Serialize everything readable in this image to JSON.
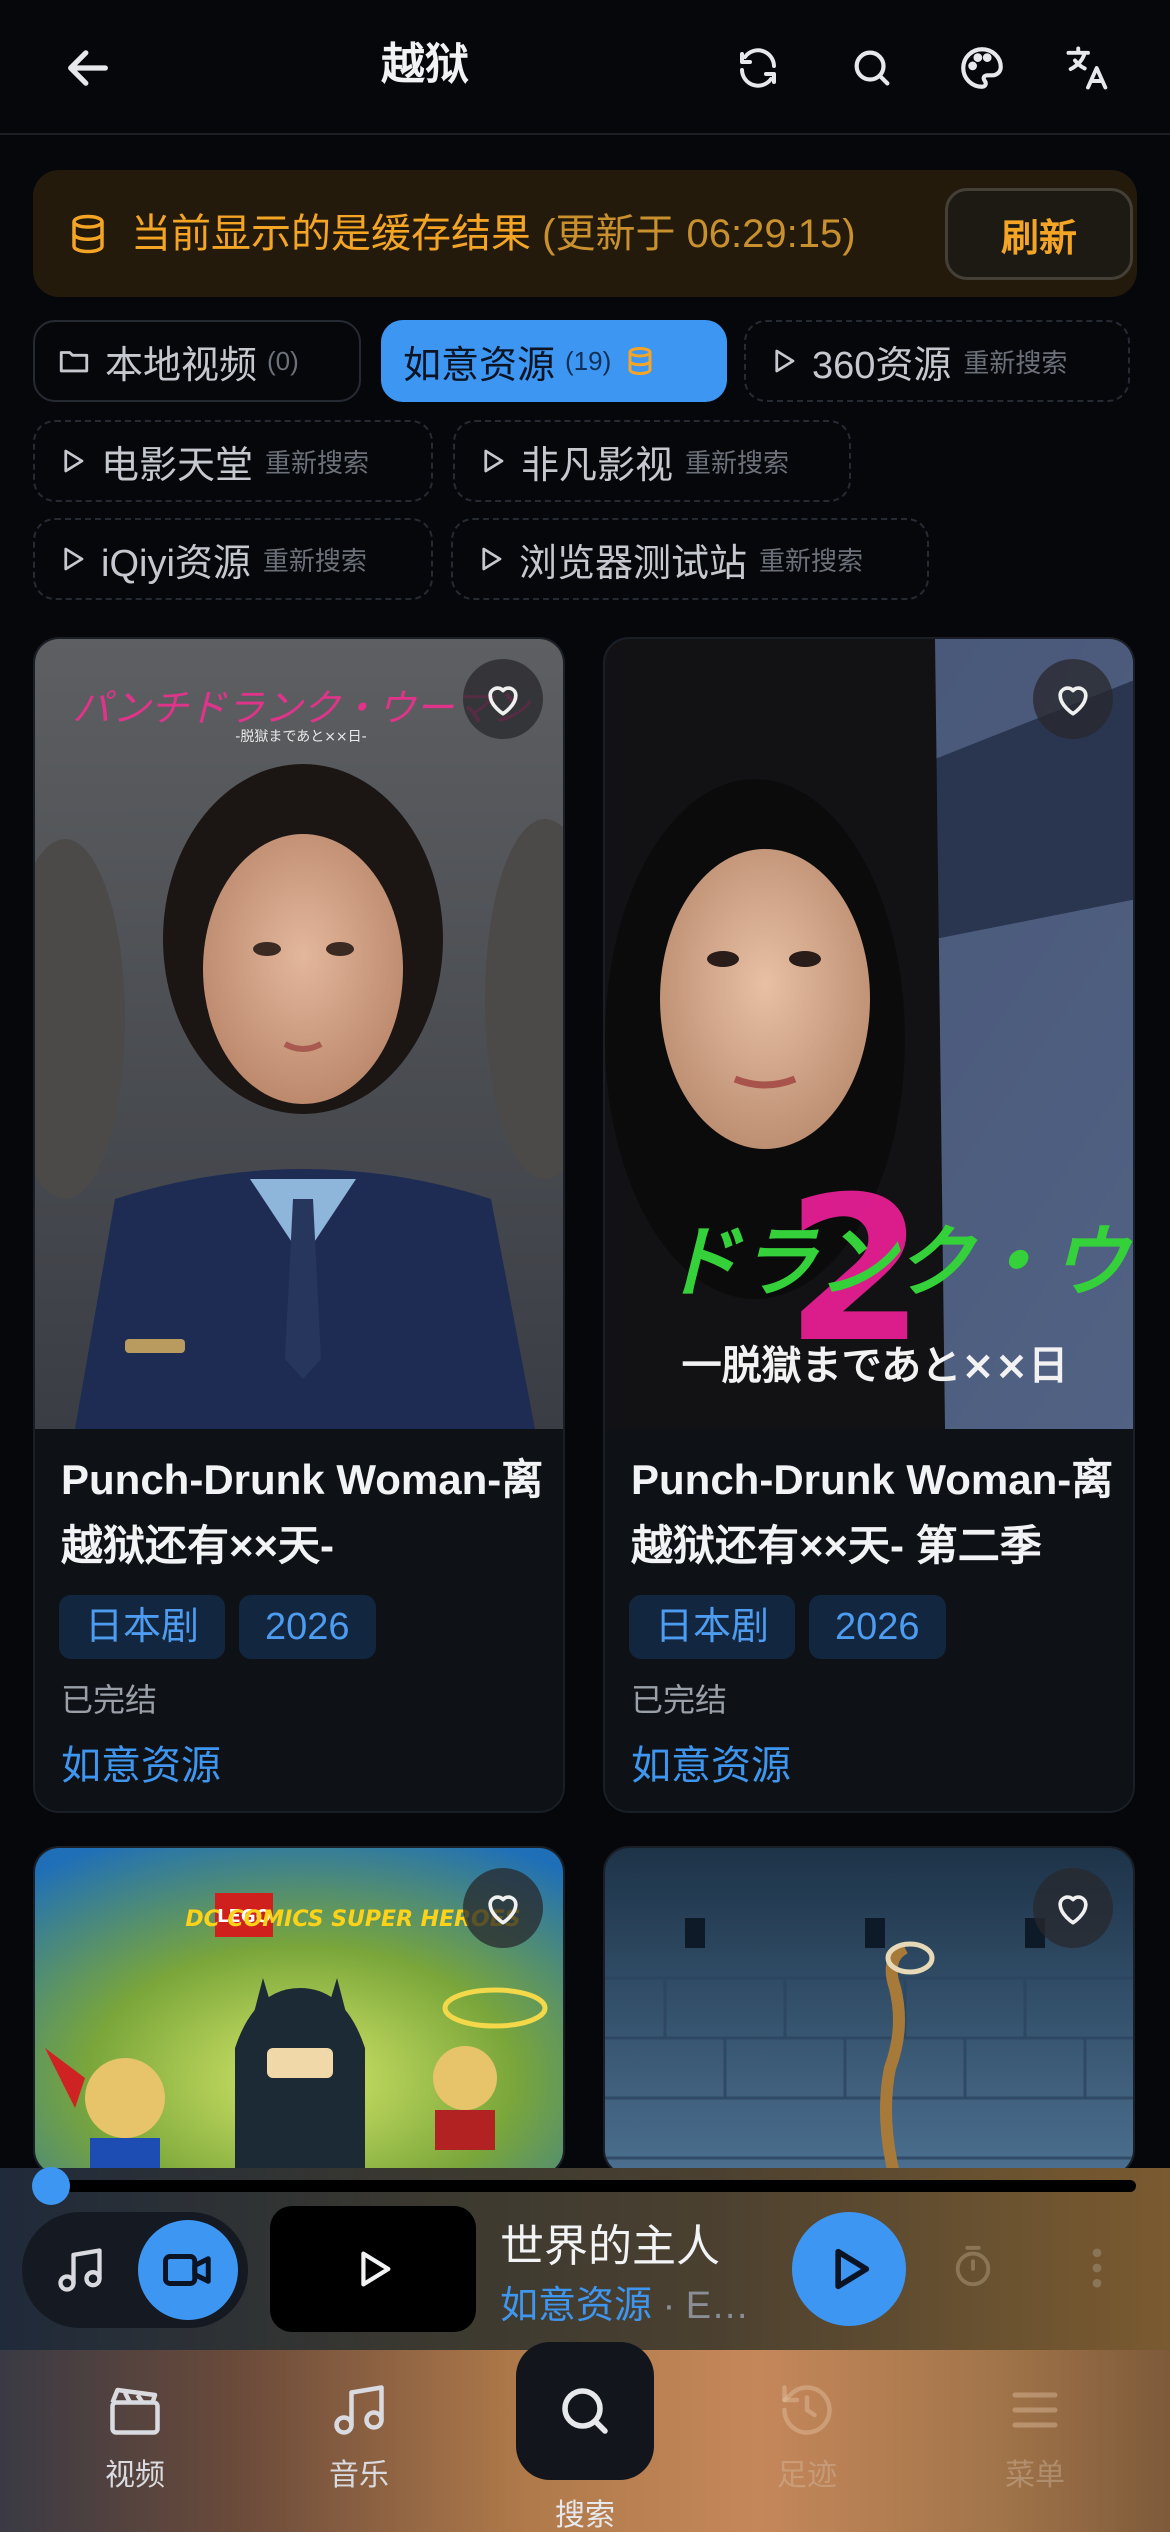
{
  "header": {
    "title": "越狱"
  },
  "banner": {
    "text": "当前显示的是缓存结果",
    "time_text": "(更新于 06:29:15)",
    "refresh_label": "刷新"
  },
  "sources": [
    {
      "name": "本地视频",
      "count": "(0)",
      "hint": ""
    },
    {
      "name": "如意资源",
      "count": "(19)",
      "hint": ""
    },
    {
      "name": "360资源",
      "count": "",
      "hint": "重新搜索"
    },
    {
      "name": "电影天堂",
      "count": "",
      "hint": "重新搜索"
    },
    {
      "name": "非凡影视",
      "count": "",
      "hint": "重新搜索"
    },
    {
      "name": "iQiyi资源",
      "count": "",
      "hint": "重新搜索"
    },
    {
      "name": "浏览器测试站",
      "count": "",
      "hint": "重新搜索"
    }
  ],
  "results": [
    {
      "title": "Punch-Drunk Woman-离越狱还有××天-",
      "tags": [
        "日本剧",
        "2026"
      ],
      "status": "已完结",
      "source": "如意资源",
      "poster_text": "パンチドランク・ウーマン",
      "poster_sub": "-脱獄まであと××日-"
    },
    {
      "title": "Punch-Drunk Woman-离越狱还有××天- 第二季",
      "tags": [
        "日本剧",
        "2026"
      ],
      "status": "已完结",
      "source": "如意资源",
      "poster_text": "ドランク・ウ",
      "poster_sub": "一脱獄まであと××日"
    },
    {
      "title": "",
      "tags": [],
      "status": "",
      "source": "",
      "poster_text": "LEGO",
      "poster_sub": "DC COMICS SUPER HEROES"
    },
    {
      "title": "",
      "tags": [],
      "status": "",
      "source": "",
      "poster_text": "",
      "poster_sub": ""
    }
  ],
  "player": {
    "title": "世界的主人",
    "source": "如意资源",
    "detail": " · E…",
    "progress": 0.0
  },
  "nav": {
    "video": "视频",
    "music": "音乐",
    "search": "搜索",
    "history": "足迹",
    "menu": "菜单"
  },
  "colors": {
    "accent": "#3d97f2",
    "warning": "#f4a525",
    "background": "#05070b"
  }
}
